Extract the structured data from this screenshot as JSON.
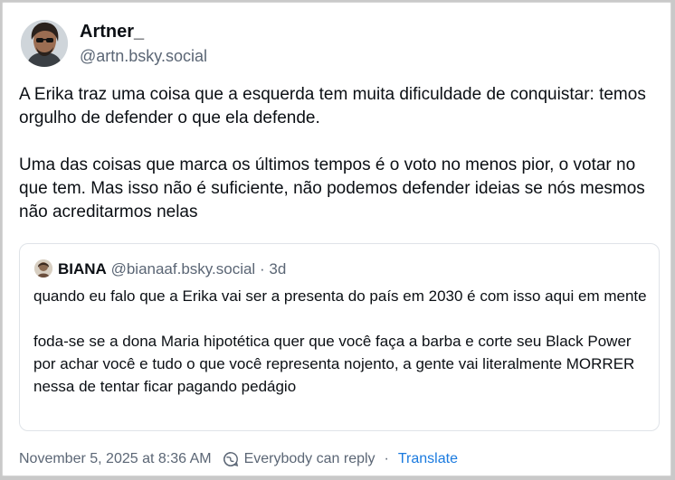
{
  "post": {
    "author_name": "Artner_",
    "author_handle": "@artn.bsky.social",
    "paragraphs": [
      "A Erika traz uma coisa que a esquerda tem muita dificuldade de conquistar: temos orgulho de defender o que ela defende.",
      "Uma das coisas que marca os últimos tempos é o voto no menos pior, o votar no que tem. Mas isso não é suficiente, não podemos defender ideias se nós mesmos não acreditarmos nelas"
    ]
  },
  "quote": {
    "author_name": "BIANA",
    "author_handle": "@bianaaf.bsky.social",
    "separator": "·",
    "age": "3d",
    "paragraphs": [
      "quando eu falo que a Erika vai ser a presenta do país em 2030 é com isso aqui em mente",
      "foda-se se a dona Maria hipotética quer que você faça a barba e corte seu Black Power por achar você e tudo o que você representa nojento, a gente vai literalmente MORRER nessa de tentar ficar pagando pedágio"
    ]
  },
  "footer": {
    "timestamp": "November 5, 2025 at 8:36 AM",
    "reply_setting": "Everybody can reply",
    "separator": "·",
    "translate_label": "Translate"
  },
  "icons": {
    "reply_setting_icon": "globe-chat-icon"
  },
  "colors": {
    "link": "#1a7adf",
    "muted": "#5b6675",
    "text": "#0b0f14"
  }
}
